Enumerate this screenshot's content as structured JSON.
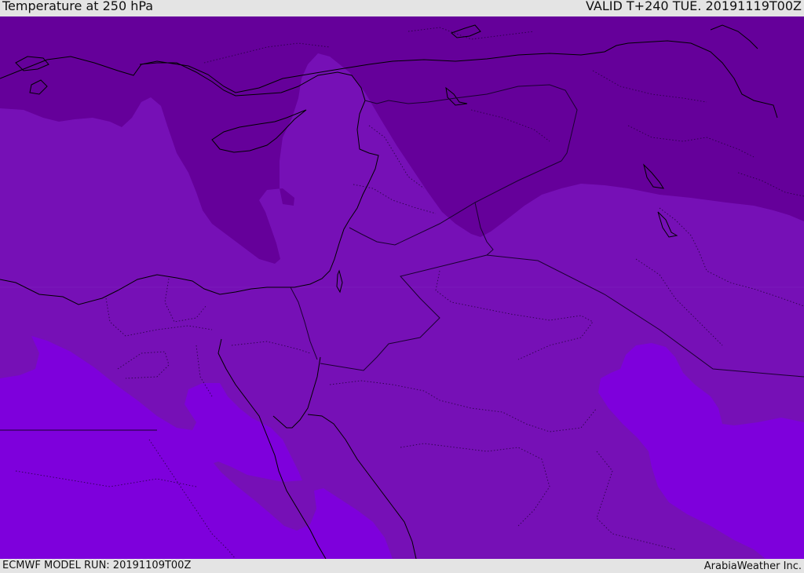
{
  "header": {
    "title": "Temperature at 250 hPa",
    "valid": "VALID T+240 TUE. 20191119T00Z"
  },
  "footer": {
    "model_run": "ECMWF MODEL RUN: 20191109T00Z",
    "credit": "ArabiaWeather Inc."
  },
  "colors": {
    "band_coldest": "#65009a",
    "band_middle": "#7610b6",
    "band_warmest": "#7e00dc",
    "coastline": "#000000",
    "border": "#1a0030"
  }
}
